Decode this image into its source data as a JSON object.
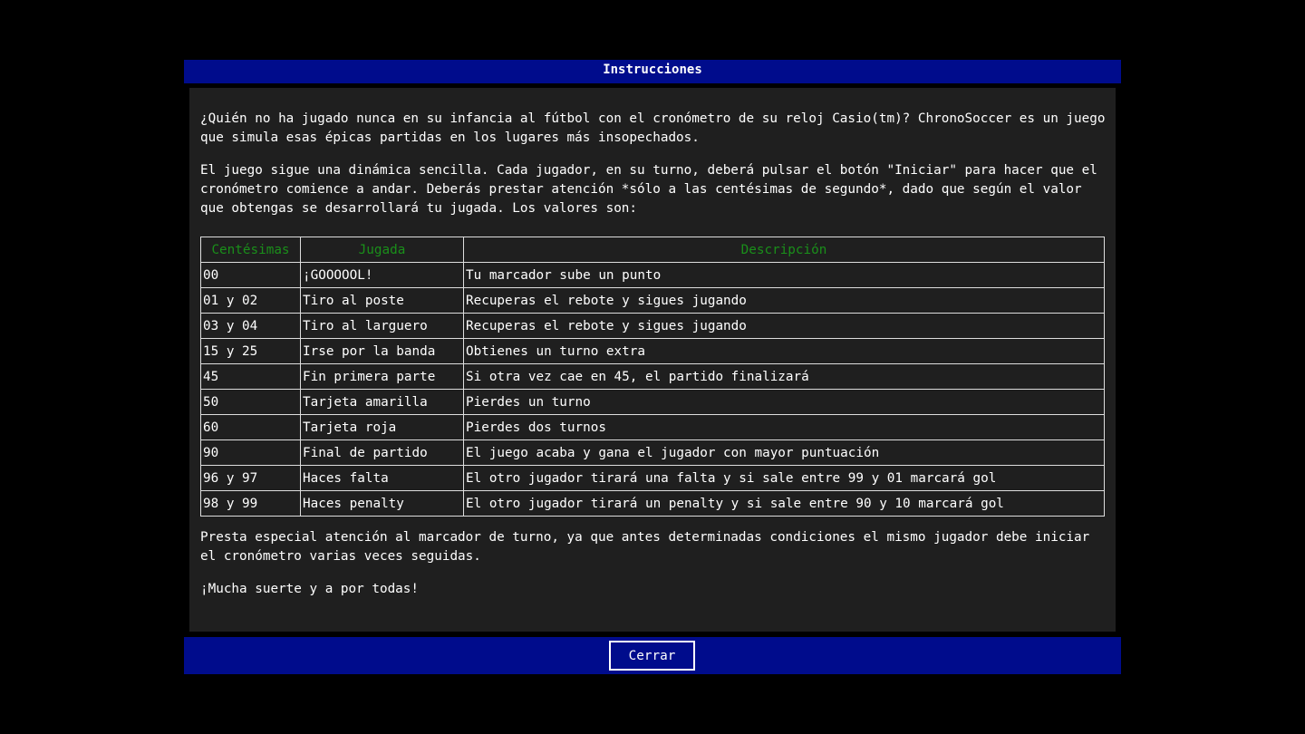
{
  "dialog": {
    "title": "Instrucciones",
    "intro": "¿Quién no ha jugado nunca en su infancia al fútbol con el cronómetro de su reloj Casio(tm)? ChronoSoccer es un juego que simula esas épicas partidas en los lugares más insopechados.",
    "rules": "El juego sigue una dinámica sencilla. Cada jugador, en su turno, deberá pulsar el botón \"Iniciar\" para hacer que el cronómetro comience a andar. Deberás prestar atención *sólo a las centésimas de segundo*, dado que según el valor que obtengas se desarrollará tu jugada. Los valores son:",
    "table": {
      "headers": [
        "Centésimas",
        "Jugada",
        "Descripción"
      ],
      "rows": [
        [
          "00",
          "¡GOOOOOL!",
          "Tu marcador sube un punto"
        ],
        [
          "01 y 02",
          "Tiro al poste",
          "Recuperas el rebote y sigues jugando"
        ],
        [
          "03 y 04",
          "Tiro al larguero",
          "Recuperas el rebote y sigues jugando"
        ],
        [
          "15 y 25",
          "Irse por la banda",
          "Obtienes un turno extra"
        ],
        [
          "45",
          "Fin primera parte",
          "Si otra vez cae en 45, el partido finalizará"
        ],
        [
          "50",
          "Tarjeta amarilla",
          "Pierdes un turno"
        ],
        [
          "60",
          "Tarjeta roja",
          "Pierdes dos turnos"
        ],
        [
          "90",
          "Final de partido",
          "El juego acaba y gana el jugador con mayor puntuación"
        ],
        [
          "96 y 97",
          "Haces falta",
          "El otro jugador tirará una falta y si sale entre 99 y 01 marcará gol"
        ],
        [
          "98 y 99",
          "Haces penalty",
          "El otro jugador tirará un penalty y si sale entre 90 y 10 marcará gol"
        ]
      ]
    },
    "note": "Presta especial atención al marcador de turno, ya que antes determinadas condiciones el mismo jugador debe iniciar el cronómetro varias veces seguidas.",
    "farewell": "¡Mucha suerte y a por todas!",
    "close_label": "Cerrar"
  },
  "colors": {
    "title_bar": "#000c8c",
    "panel_bg": "#1f1f1f",
    "header_text": "#1a8f1a"
  }
}
